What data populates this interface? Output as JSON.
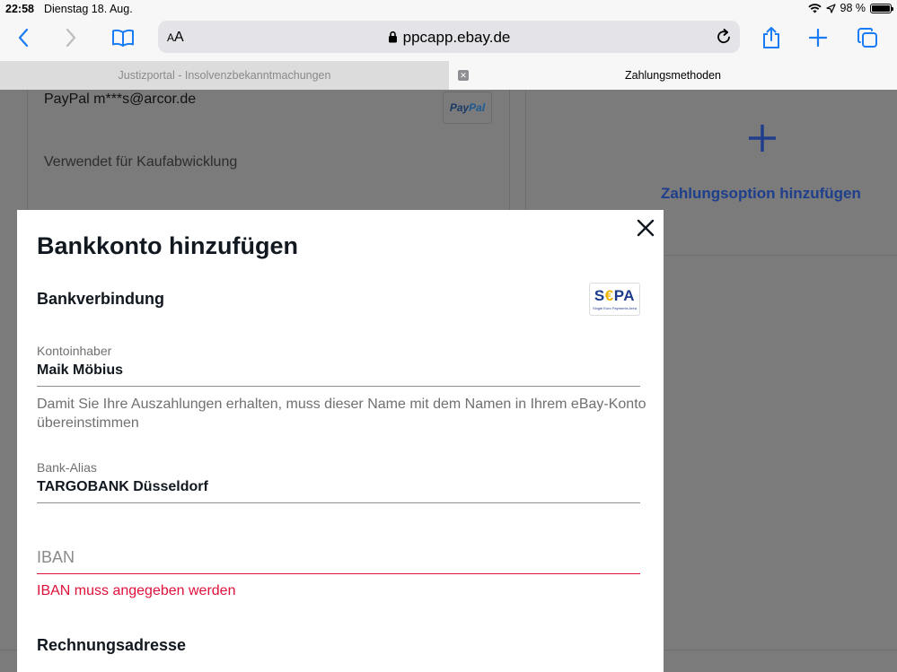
{
  "status": {
    "time": "22:58",
    "date": "Dienstag 18. Aug.",
    "battery": "98 %",
    "battery_level": 0.98
  },
  "toolbar": {
    "aa_small": "A",
    "aa_large": "A",
    "url": "ppcapp.ebay.de"
  },
  "tabs": [
    {
      "label": "Justizportal - Insolvenzbekanntmachungen",
      "active": false
    },
    {
      "label": "Zahlungsmethoden",
      "active": true
    }
  ],
  "background": {
    "paypal_account": "PayPal m***s@arcor.de",
    "paypal_badge_1": "Pay",
    "paypal_badge_2": "Pal",
    "used_for": "Verwendet für Kaufabwicklung",
    "add_payment_option": "Zahlungsoption hinzufügen"
  },
  "modal": {
    "title": "Bankkonto hinzufügen",
    "section_bank": "Bankverbindung",
    "sepa_logo_1": "S",
    "sepa_logo_2": "€",
    "sepa_logo_3": "PA",
    "sepa_subtitle": "Single Euro Payments Area",
    "account_holder_label": "Kontoinhaber",
    "account_holder_value": "Maik Möbius",
    "account_holder_hint": "Damit Sie Ihre Auszahlungen erhalten, muss dieser Name mit dem Namen in Ihrem eBay-Konto übereinstimmen",
    "bank_alias_label": "Bank-Alias",
    "bank_alias_value": "TARGOBANK Düsseldorf",
    "iban_placeholder": "IBAN",
    "iban_value": "",
    "iban_error": "IBAN muss angegeben werden",
    "section_billing": "Rechnungsadresse"
  },
  "colors": {
    "accent": "#1f3e8c",
    "error": "#e0103a",
    "safari_blue": "#1a7cf5"
  }
}
